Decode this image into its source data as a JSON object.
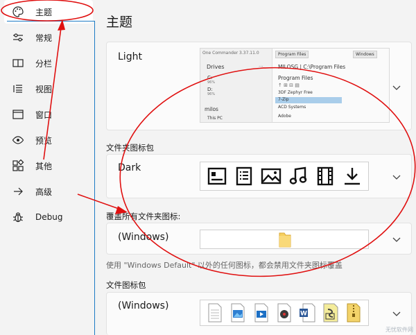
{
  "sidebar": {
    "items": [
      {
        "label": "主题",
        "icon": "palette-icon"
      },
      {
        "label": "常规",
        "icon": "sliders-icon"
      },
      {
        "label": "分栏",
        "icon": "columns-icon"
      },
      {
        "label": "视图",
        "icon": "list-view-icon"
      },
      {
        "label": "窗口",
        "icon": "window-icon"
      },
      {
        "label": "预览",
        "icon": "eye-icon"
      },
      {
        "label": "其他",
        "icon": "apps-icon"
      },
      {
        "label": "高级",
        "icon": "arrow-right-icon"
      },
      {
        "label": "Debug",
        "icon": "bug-icon"
      }
    ]
  },
  "main": {
    "title": "主题",
    "theme": {
      "value": "Light",
      "preview": {
        "title_left": "One Commander 3.37.11.0",
        "tab1": "Program Files",
        "tab2": "Windows",
        "drives_label": "Drives",
        "path": "MILOSG | C:\\Program Files",
        "folder_header": "Program Files",
        "drive_c": "C:",
        "drive_c_size": "96%",
        "drive_d": "D:",
        "drive_d_size": "96%",
        "user": "milos",
        "pc": "This PC",
        "files": [
          "3DF Zephyr Free",
          "7-Zip",
          "ACD Systems",
          "Adobe"
        ]
      }
    },
    "folder_icon_pack": {
      "label": "文件夹图标包",
      "value": "Dark"
    },
    "override_folder_icon": {
      "label": "覆盖所有文件夹图标:",
      "value": "(Windows)"
    },
    "note": "使用 \"Windows Default\" 以外的任何图标，都会禁用文件夹图标覆盖",
    "file_icon_pack": {
      "label": "文件图标包",
      "value": "(Windows)"
    }
  },
  "watermark": "无忧软件网",
  "colors": {
    "annotation": "#e01010",
    "accent": "#1b7ac4"
  }
}
